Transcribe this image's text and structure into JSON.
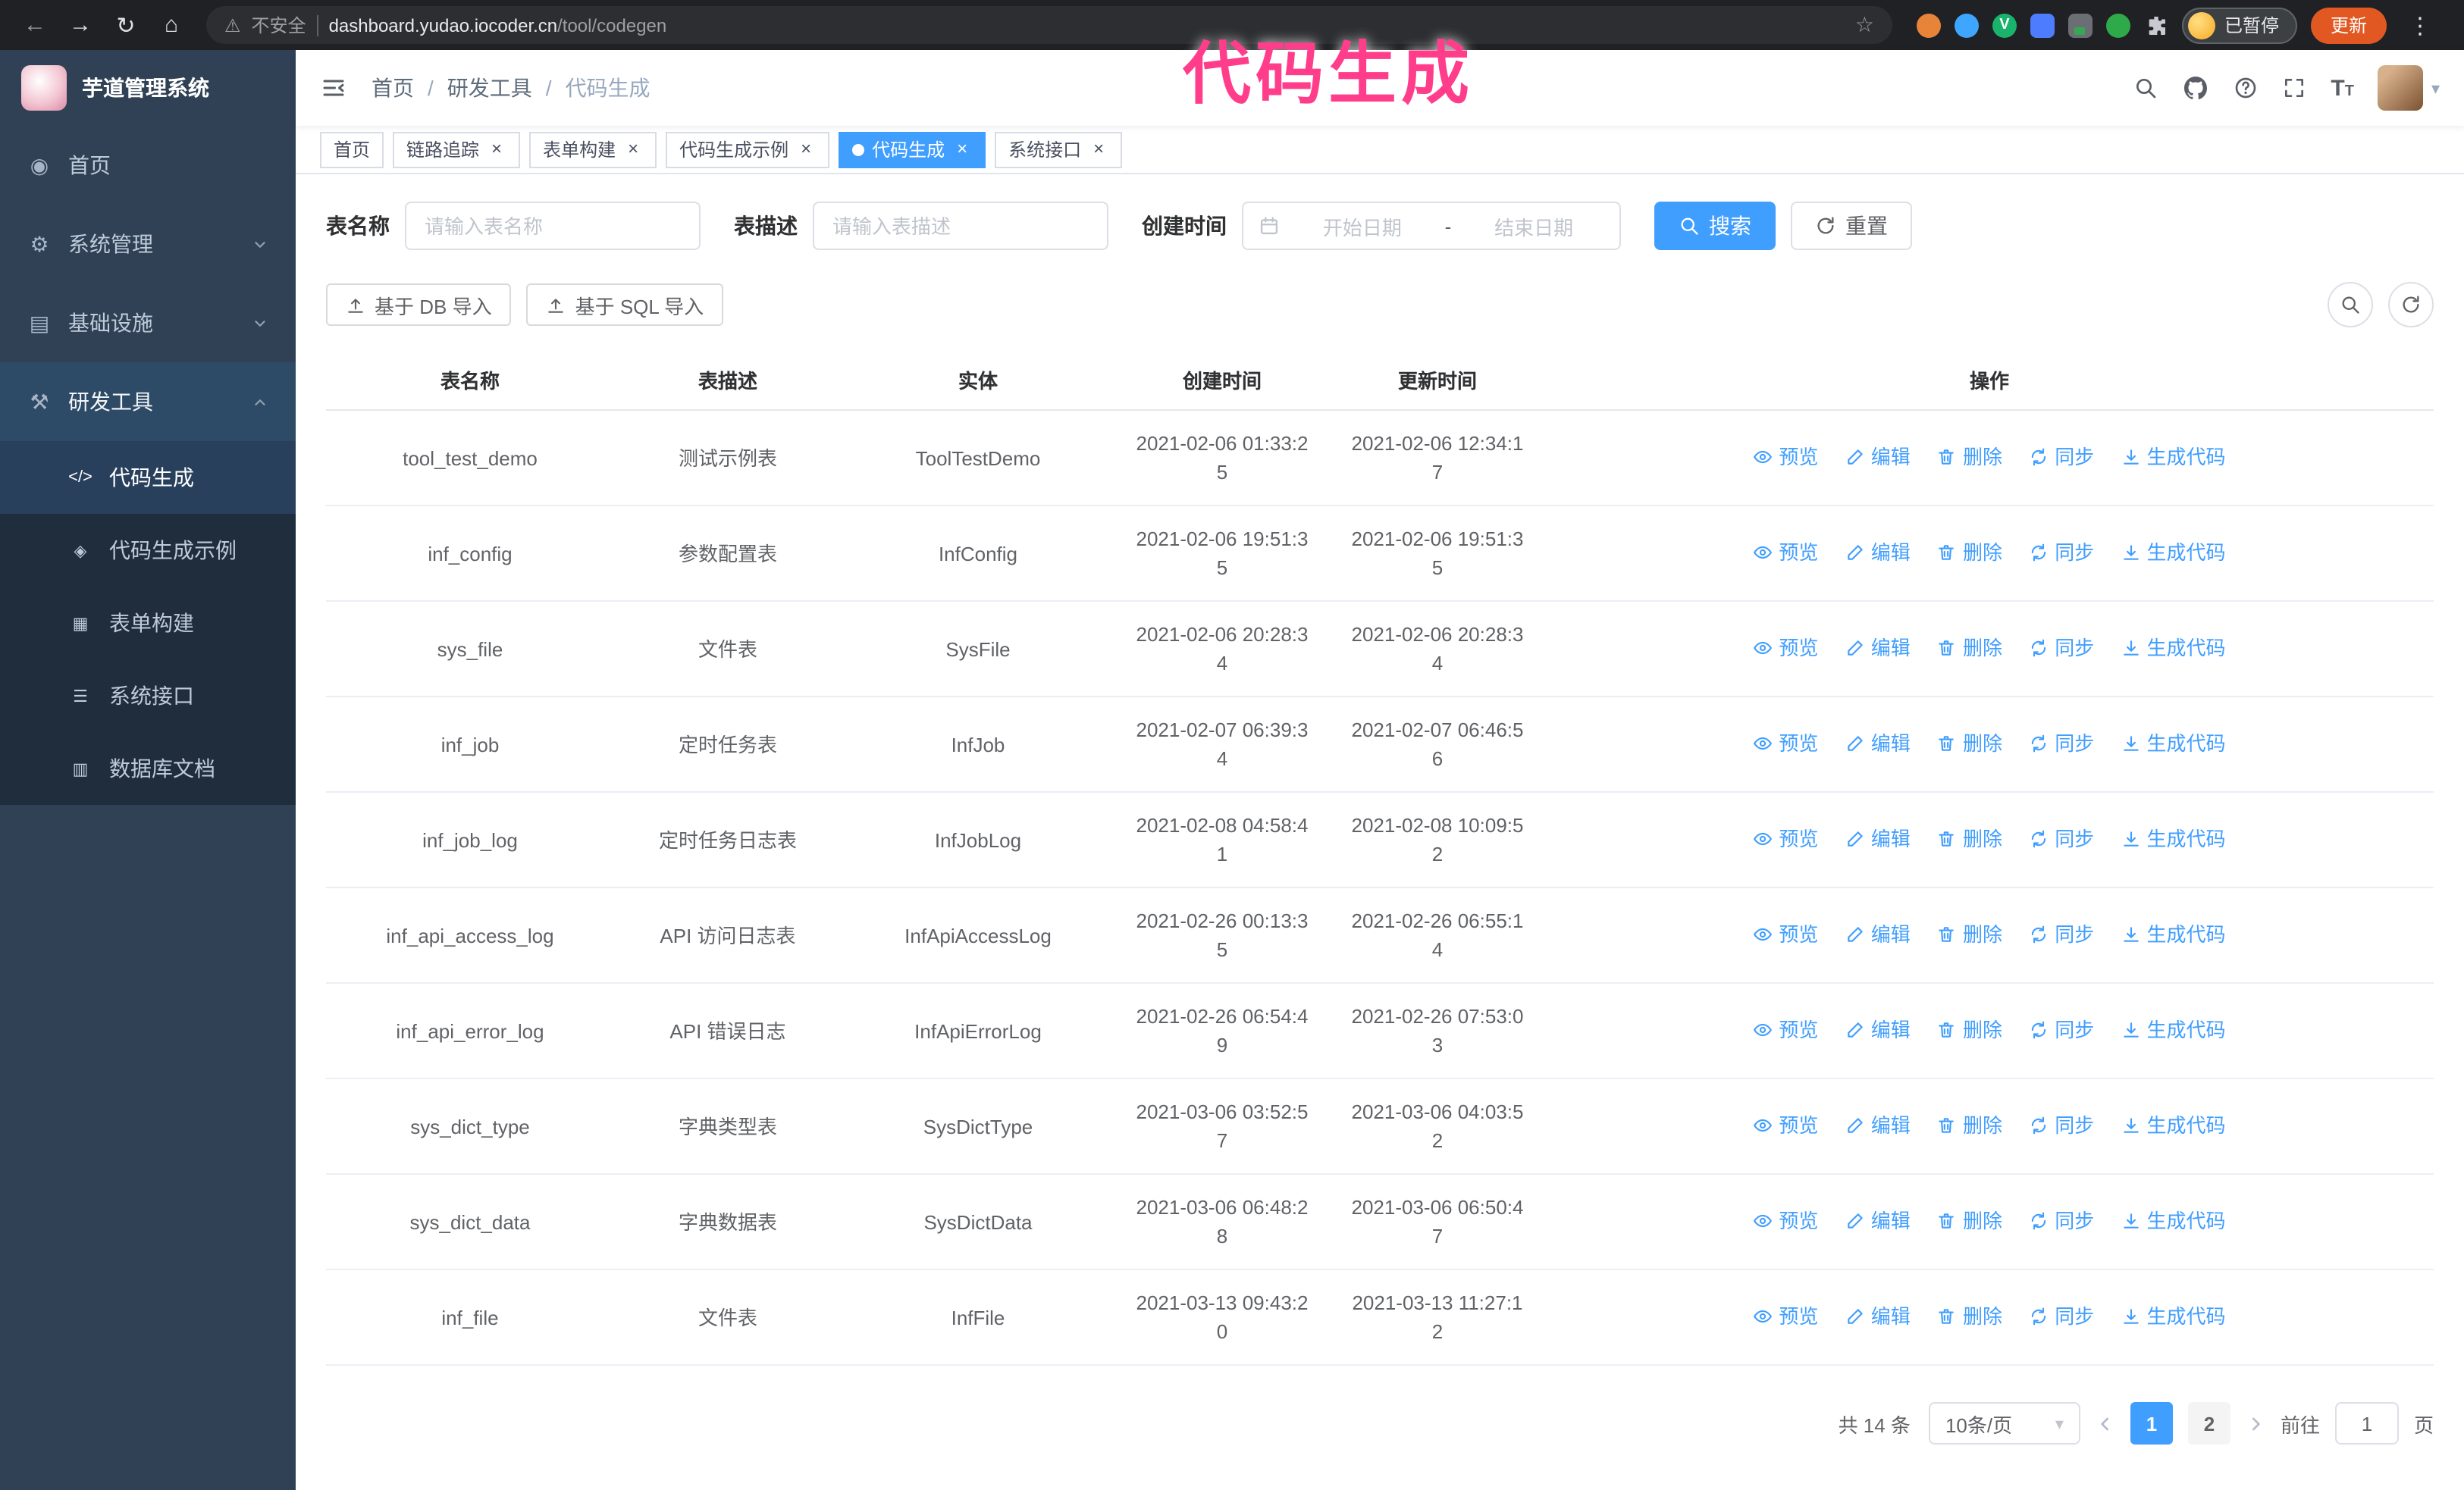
{
  "browser": {
    "security_label": "不安全",
    "url_host": "dashboard.yudao.iocoder.cn",
    "url_path": "/tool/codegen",
    "paused_badge": "已暂停",
    "update_button": "更新"
  },
  "annotation": {
    "text": "代码生成",
    "color": "#ff3d8b"
  },
  "icons": {
    "back": "←",
    "forward": "→",
    "reload": "↻",
    "home": "⌂",
    "warning": "⚠",
    "star": "☆",
    "menu_dots": "⋮",
    "caret_down": "▾",
    "close": "×",
    "ext_v": "V",
    "sidebar_home": "◉",
    "sidebar_system": "⚙",
    "sidebar_infra": "▤",
    "sidebar_tools": "⚒",
    "sub_codegen": "</>",
    "sub_demo": "◈",
    "sub_form": "▦",
    "sub_api": "☰",
    "sub_db": "▥",
    "font_size_large": "T",
    "font_size_small": "T"
  },
  "sidebar": {
    "logo_title": "芋道管理系统",
    "items": [
      {
        "label": "首页"
      },
      {
        "label": "系统管理"
      },
      {
        "label": "基础设施"
      },
      {
        "label": "研发工具"
      }
    ],
    "subitems": [
      {
        "label": "代码生成"
      },
      {
        "label": "代码生成示例"
      },
      {
        "label": "表单构建"
      },
      {
        "label": "系统接口"
      },
      {
        "label": "数据库文档"
      }
    ]
  },
  "navbar": {
    "breadcrumb": {
      "home": "首页",
      "sep": "/",
      "parent": "研发工具",
      "current": "代码生成"
    }
  },
  "tabs": [
    {
      "label": "首页"
    },
    {
      "label": "链路追踪"
    },
    {
      "label": "表单构建"
    },
    {
      "label": "代码生成示例"
    },
    {
      "label": "代码生成"
    },
    {
      "label": "系统接口"
    }
  ],
  "filters": {
    "name_label": "表名称",
    "name_placeholder": "请输入表名称",
    "desc_label": "表描述",
    "desc_placeholder": "请输入表描述",
    "time_label": "创建时间",
    "start_placeholder": "开始日期",
    "range_separator": "-",
    "end_placeholder": "结束日期",
    "search": "搜索",
    "reset": "重置"
  },
  "toolbar": {
    "import_db": "基于 DB 导入",
    "import_sql": "基于 SQL 导入"
  },
  "table": {
    "columns": {
      "name": "表名称",
      "desc": "表描述",
      "entity": "实体",
      "created": "创建时间",
      "updated": "更新时间",
      "actions": "操作"
    },
    "action_labels": {
      "preview": "预览",
      "edit": "编辑",
      "delete": "删除",
      "sync": "同步",
      "generate": "生成代码"
    },
    "rows": [
      {
        "name": "tool_test_demo",
        "desc": "测试示例表",
        "entity": "ToolTestDemo",
        "created": "2021-02-06 01:33:25",
        "updated": "2021-02-06 12:34:17"
      },
      {
        "name": "inf_config",
        "desc": "参数配置表",
        "entity": "InfConfig",
        "created": "2021-02-06 19:51:35",
        "updated": "2021-02-06 19:51:35"
      },
      {
        "name": "sys_file",
        "desc": "文件表",
        "entity": "SysFile",
        "created": "2021-02-06 20:28:34",
        "updated": "2021-02-06 20:28:34"
      },
      {
        "name": "inf_job",
        "desc": "定时任务表",
        "entity": "InfJob",
        "created": "2021-02-07 06:39:34",
        "updated": "2021-02-07 06:46:56"
      },
      {
        "name": "inf_job_log",
        "desc": "定时任务日志表",
        "entity": "InfJobLog",
        "created": "2021-02-08 04:58:41",
        "updated": "2021-02-08 10:09:52"
      },
      {
        "name": "inf_api_access_log",
        "desc": "API 访问日志表",
        "entity": "InfApiAccessLog",
        "created": "2021-02-26 00:13:35",
        "updated": "2021-02-26 06:55:14"
      },
      {
        "name": "inf_api_error_log",
        "desc": "API 错误日志",
        "entity": "InfApiErrorLog",
        "created": "2021-02-26 06:54:49",
        "updated": "2021-02-26 07:53:03"
      },
      {
        "name": "sys_dict_type",
        "desc": "字典类型表",
        "entity": "SysDictType",
        "created": "2021-03-06 03:52:57",
        "updated": "2021-03-06 04:03:52"
      },
      {
        "name": "sys_dict_data",
        "desc": "字典数据表",
        "entity": "SysDictData",
        "created": "2021-03-06 06:48:28",
        "updated": "2021-03-06 06:50:47"
      },
      {
        "name": "inf_file",
        "desc": "文件表",
        "entity": "InfFile",
        "created": "2021-03-13 09:43:20",
        "updated": "2021-03-13 11:27:12"
      }
    ]
  },
  "pagination": {
    "total": "共 14 条",
    "page_size": "10条/页",
    "page1": "1",
    "page2": "2",
    "goto_label": "前往",
    "goto_value": "1",
    "goto_suffix": "页"
  },
  "colors": {
    "accent": "#409eff",
    "sidebar_bg": "#304156",
    "submenu_bg": "#1f2d3d",
    "tab_active_bg": "#409eff",
    "annotation_pink": "#ff3d8b"
  }
}
